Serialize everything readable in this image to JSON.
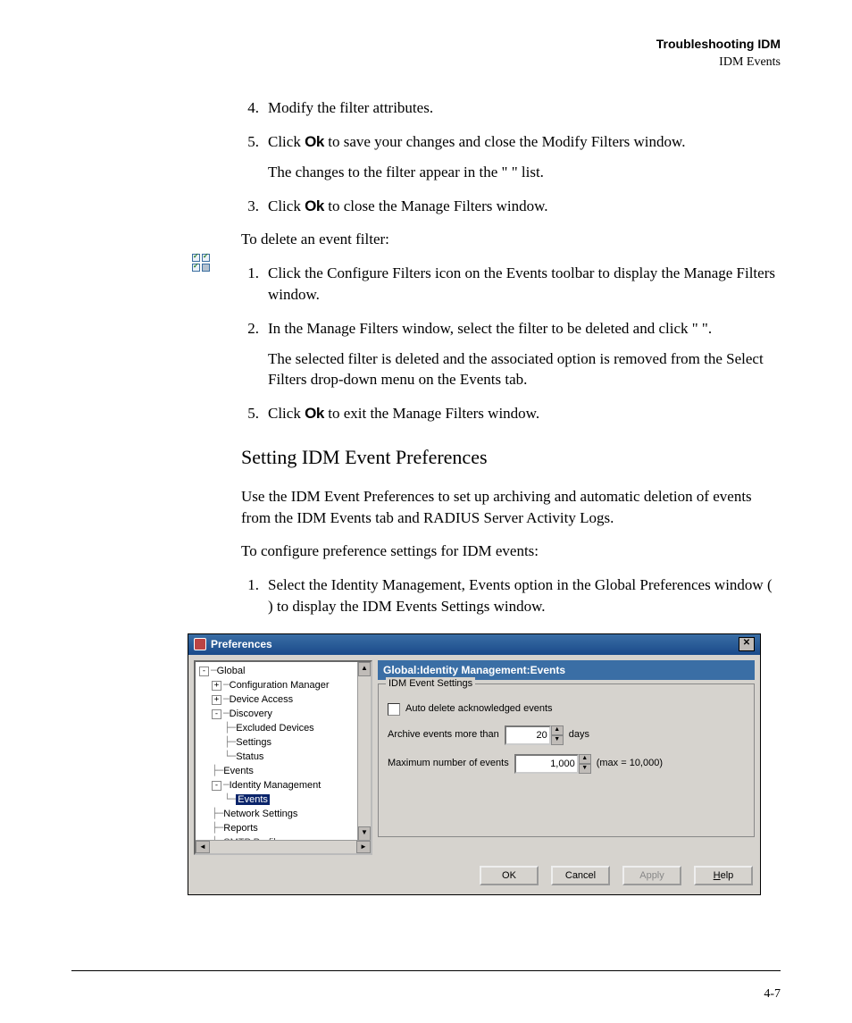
{
  "header": {
    "title": "Troubleshooting IDM",
    "subtitle": "IDM Events"
  },
  "steps_top": {
    "s4_num": "4.",
    "s4": "Modify the filter attributes.",
    "s5_num": "5.",
    "s5_a": "Click ",
    "s5_ok": "Ok",
    "s5_b": " to save your changes and close the Modify Filters window.",
    "s5_sub": "The changes to the filter appear in the \"                         \" list.",
    "s3_num": "3.",
    "s3_a": "Click ",
    "s3_ok": "Ok",
    "s3_b": " to close the Manage Filters window."
  },
  "delete_intro": "To delete an event filter:",
  "steps_delete": {
    "d1_num": "1.",
    "d1": "Click the Configure Filters icon on the Events toolbar to display the Manage Filters window.",
    "d2_num": "2.",
    "d2": "In the Manage Filters window, select the filter to be deleted and click \"            \".",
    "d2_sub": "The selected filter is deleted and the associated option is removed from the Select Filters drop-down menu on the Events tab.",
    "d5_num": "5.",
    "d5_a": "Click ",
    "d5_ok": "Ok",
    "d5_b": " to exit the Manage Filters window."
  },
  "section_title": "Setting IDM Event Preferences",
  "section_p1": "Use the IDM Event Preferences to set up archiving and automatic deletion of events from the IDM Events tab and RADIUS Server Activity Logs.",
  "section_p2": "To configure preference settings for IDM events:",
  "steps_pref": {
    "p1_num": "1.",
    "p1": "Select the Identity Management, Events option in the Global Preferences window (                                                                                            ) to display the IDM Events Settings window."
  },
  "pref_window": {
    "title": "Preferences",
    "tree": {
      "global": "Global",
      "config_mgr": "Configuration Manager",
      "device_access": "Device Access",
      "discovery": "Discovery",
      "excluded": "Excluded Devices",
      "settings": "Settings",
      "status": "Status",
      "events": "Events",
      "identity_mgmt": "Identity Management",
      "idm_events": "Events",
      "network_settings": "Network Settings",
      "reports": "Reports",
      "smtp": "SMTP Profiles"
    },
    "right_header": "Global:Identity Management:Events",
    "groupbox": "IDM Event Settings",
    "auto_delete": "Auto delete acknowledged events",
    "archive_label_a": "Archive events more than",
    "archive_value": "20",
    "archive_label_b": "days",
    "max_label": "Maximum number of events",
    "max_value": "1,000",
    "max_suffix": "(max = 10,000)",
    "buttons": {
      "ok": "OK",
      "cancel": "Cancel",
      "apply": "Apply",
      "help": "Help"
    }
  },
  "page_number": "4-7"
}
